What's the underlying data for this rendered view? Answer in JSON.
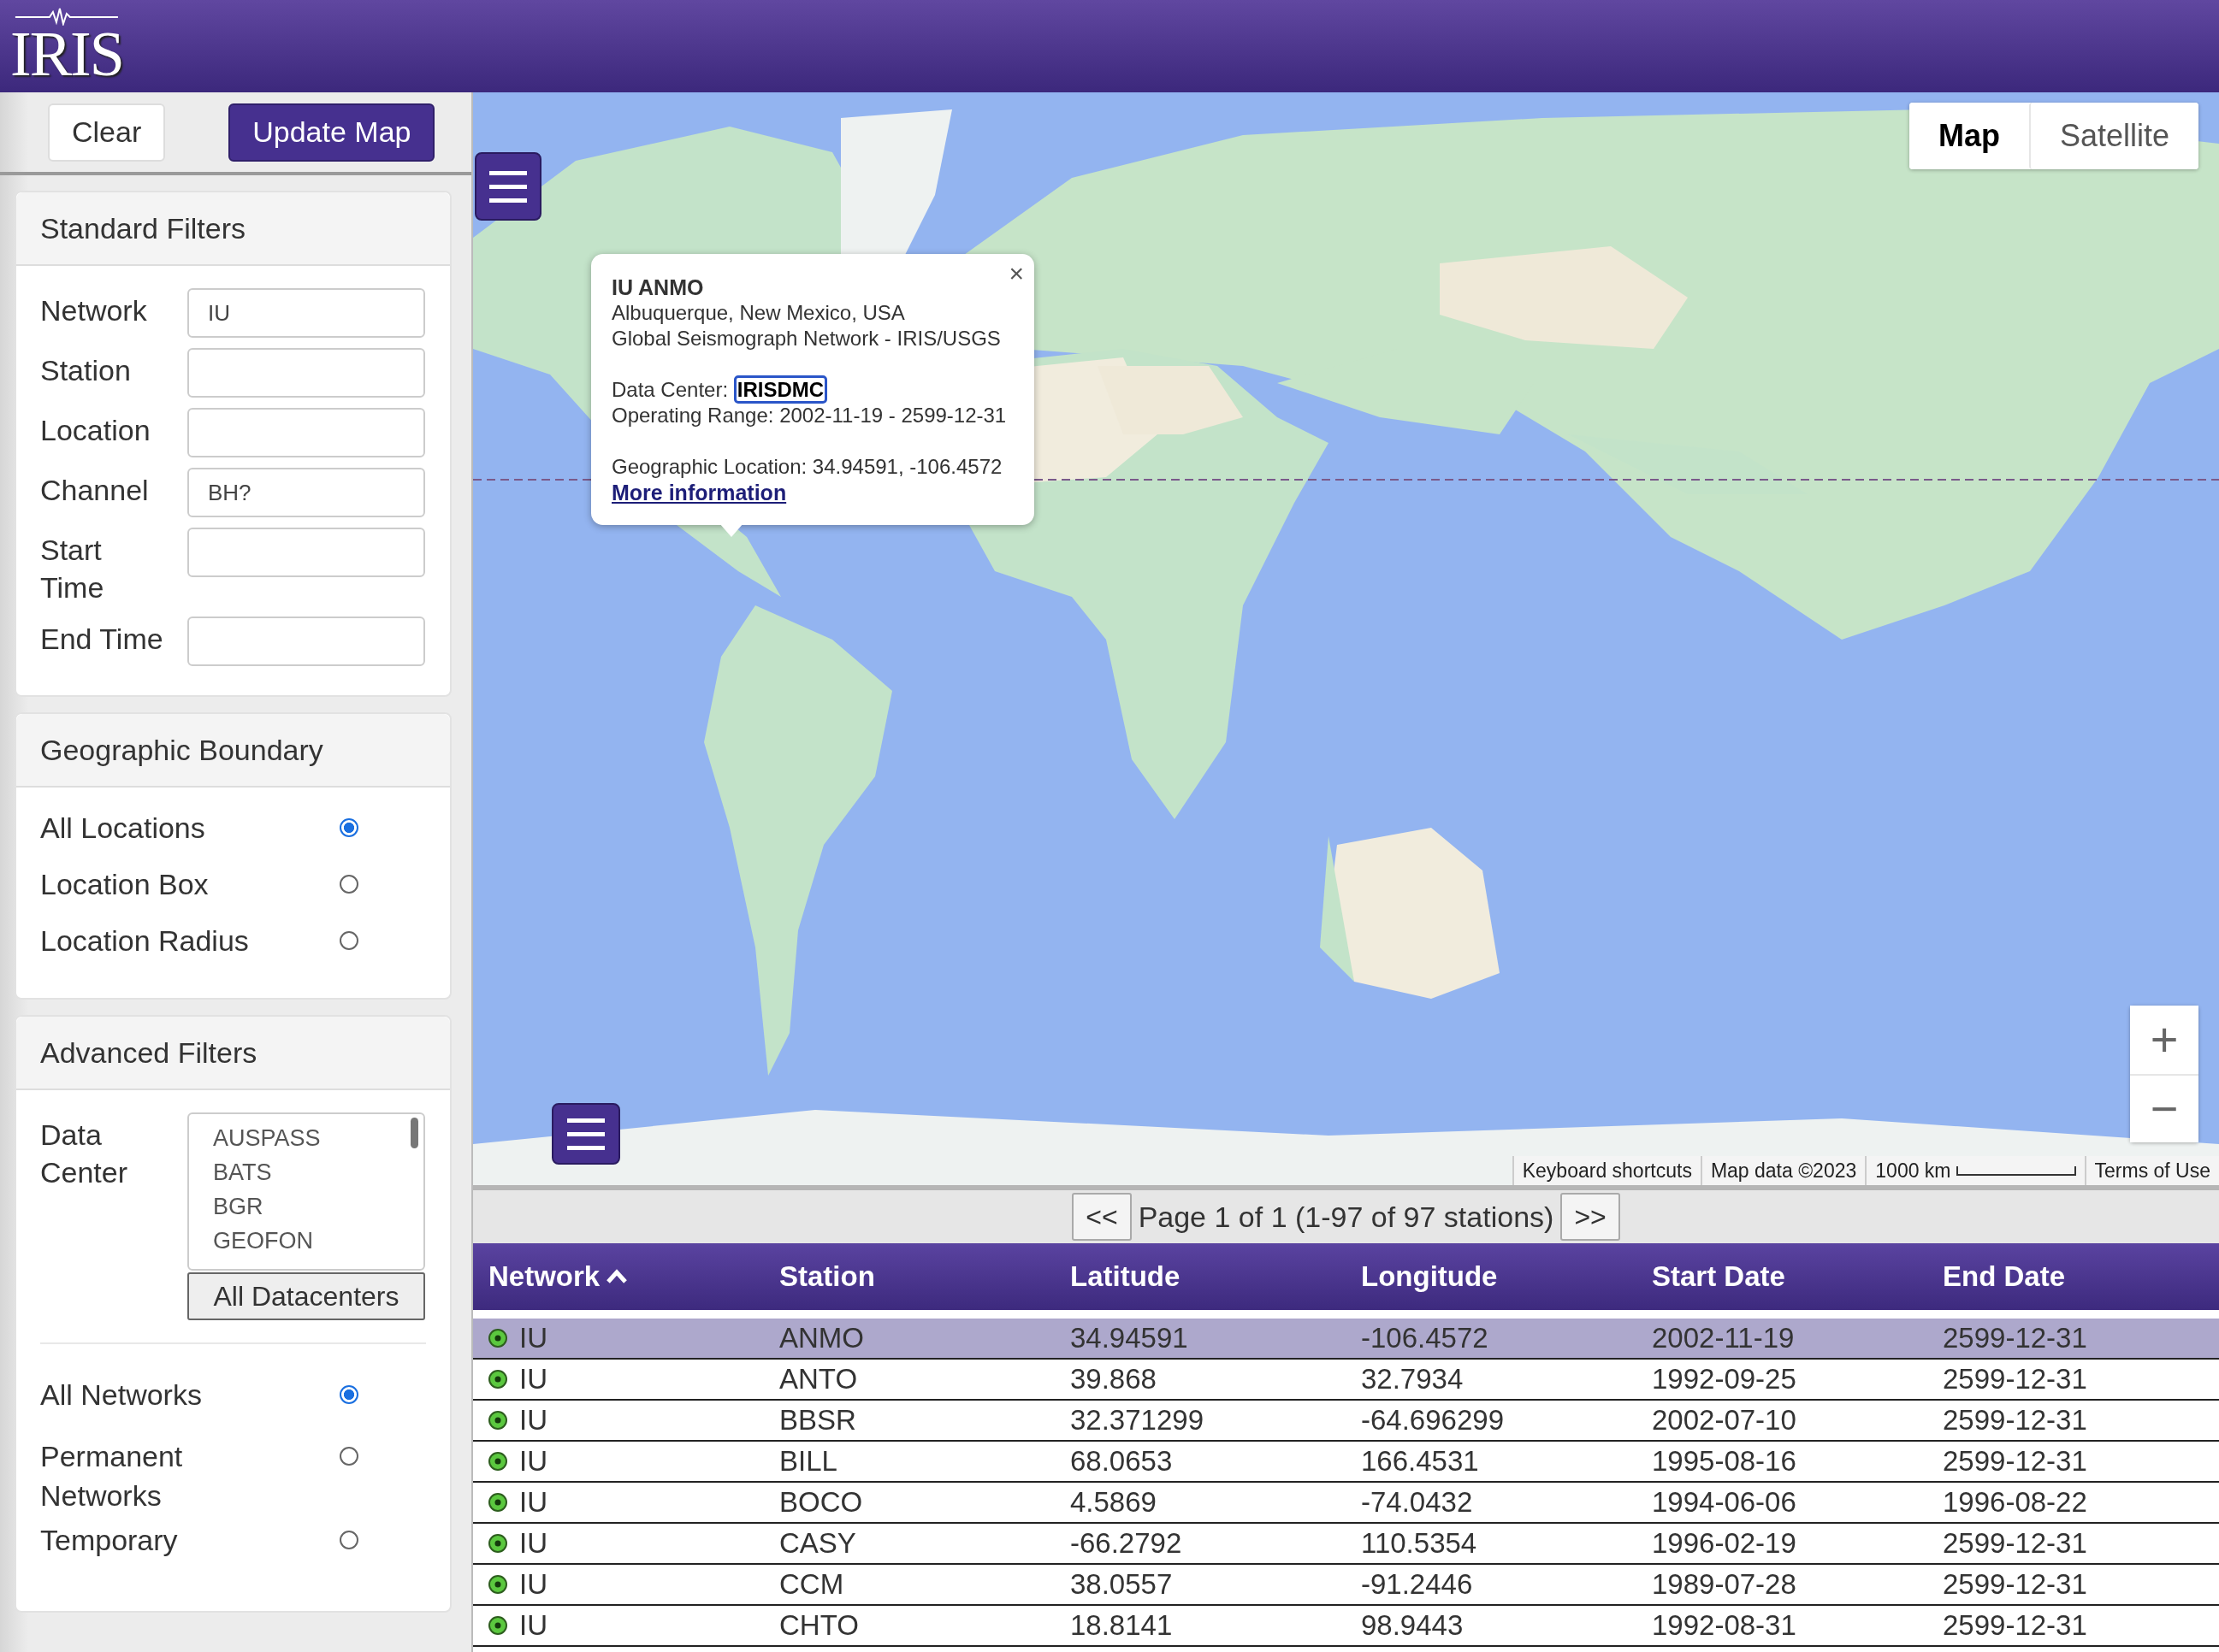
{
  "header": {
    "logo": "IRIS"
  },
  "sidebar": {
    "buttons": [
      {
        "label": "Clear",
        "kind": "plain"
      },
      {
        "label": "Update Map",
        "kind": "primary"
      }
    ],
    "standard_filters": {
      "title": "Standard Filters",
      "fields": [
        {
          "label": "Network",
          "value": "IU"
        },
        {
          "label": "Station"
        },
        {
          "label": "Location"
        },
        {
          "label": "Channel",
          "value": "BH?"
        },
        {
          "label": "Start Time"
        },
        {
          "label": "End Time"
        }
      ]
    },
    "geographic_boundary": {
      "title": "Geographic Boundary",
      "options": [
        {
          "label": "All Locations",
          "selected": true
        },
        {
          "label": "Location Box",
          "selected": false
        },
        {
          "label": "Location Radius",
          "selected": false
        }
      ]
    },
    "advanced_filters": {
      "title": "Advanced Filters",
      "data_center": {
        "label": "Data Center",
        "options": [
          "AUSPASS",
          "BATS",
          "BGR",
          "GEOFON"
        ],
        "button": "All Datacenters"
      },
      "network_types": [
        {
          "label": "All Networks",
          "selected": true
        },
        {
          "label": "Permanent Networks",
          "selected": false
        },
        {
          "label": "Temporary",
          "selected": false
        }
      ]
    }
  },
  "map": {
    "map_types": [
      {
        "label": "Map",
        "selected": true
      },
      {
        "label": "Satellite",
        "selected": false
      }
    ],
    "zoom": [
      "+",
      "−"
    ],
    "popup": {
      "title": "IU ANMO",
      "lines": [
        "Albuquerque, New Mexico, USA",
        "Global Seismograph Network - IRIS/USGS"
      ],
      "data_center_label": "Data Center:",
      "data_center": "IRISDMC",
      "operating_range": "Operating Range: 2002-11-19 - 2599-12-31",
      "location": "Geographic Location: 34.94591, -106.4572",
      "link": "More information",
      "close": "×"
    },
    "attribution": [
      "Keyboard shortcuts",
      "Map data ©2023",
      "1000 km",
      "Terms of Use"
    ]
  },
  "pager": {
    "prev": "<<",
    "text": "Page 1 of 1 (1-97 of 97 stations)",
    "next": ">>"
  },
  "table": {
    "columns": [
      {
        "label": "Network",
        "sorted": true
      },
      {
        "label": "Station"
      },
      {
        "label": "Latitude"
      },
      {
        "label": "Longitude"
      },
      {
        "label": "Start Date"
      },
      {
        "label": "End Date"
      }
    ],
    "rows": [
      {
        "selected": true,
        "cells": [
          "IU",
          "ANMO",
          "34.94591",
          "-106.4572",
          "2002-11-19",
          "2599-12-31"
        ]
      },
      {
        "selected": false,
        "cells": [
          "IU",
          "ANTO",
          "39.868",
          "32.7934",
          "1992-09-25",
          "2599-12-31"
        ]
      },
      {
        "selected": false,
        "cells": [
          "IU",
          "BBSR",
          "32.371299",
          "-64.696299",
          "2002-07-10",
          "2599-12-31"
        ]
      },
      {
        "selected": false,
        "cells": [
          "IU",
          "BILL",
          "68.0653",
          "166.4531",
          "1995-08-16",
          "2599-12-31"
        ]
      },
      {
        "selected": false,
        "cells": [
          "IU",
          "BOCO",
          "4.5869",
          "-74.0432",
          "1994-06-06",
          "1996-08-22"
        ]
      },
      {
        "selected": false,
        "cells": [
          "IU",
          "CASY",
          "-66.2792",
          "110.5354",
          "1996-02-19",
          "2599-12-31"
        ]
      },
      {
        "selected": false,
        "cells": [
          "IU",
          "CCM",
          "38.0557",
          "-91.2446",
          "1989-07-28",
          "2599-12-31"
        ]
      },
      {
        "selected": false,
        "cells": [
          "IU",
          "CHTO",
          "18.8141",
          "98.9443",
          "1992-08-31",
          "2599-12-31"
        ]
      }
    ]
  }
}
